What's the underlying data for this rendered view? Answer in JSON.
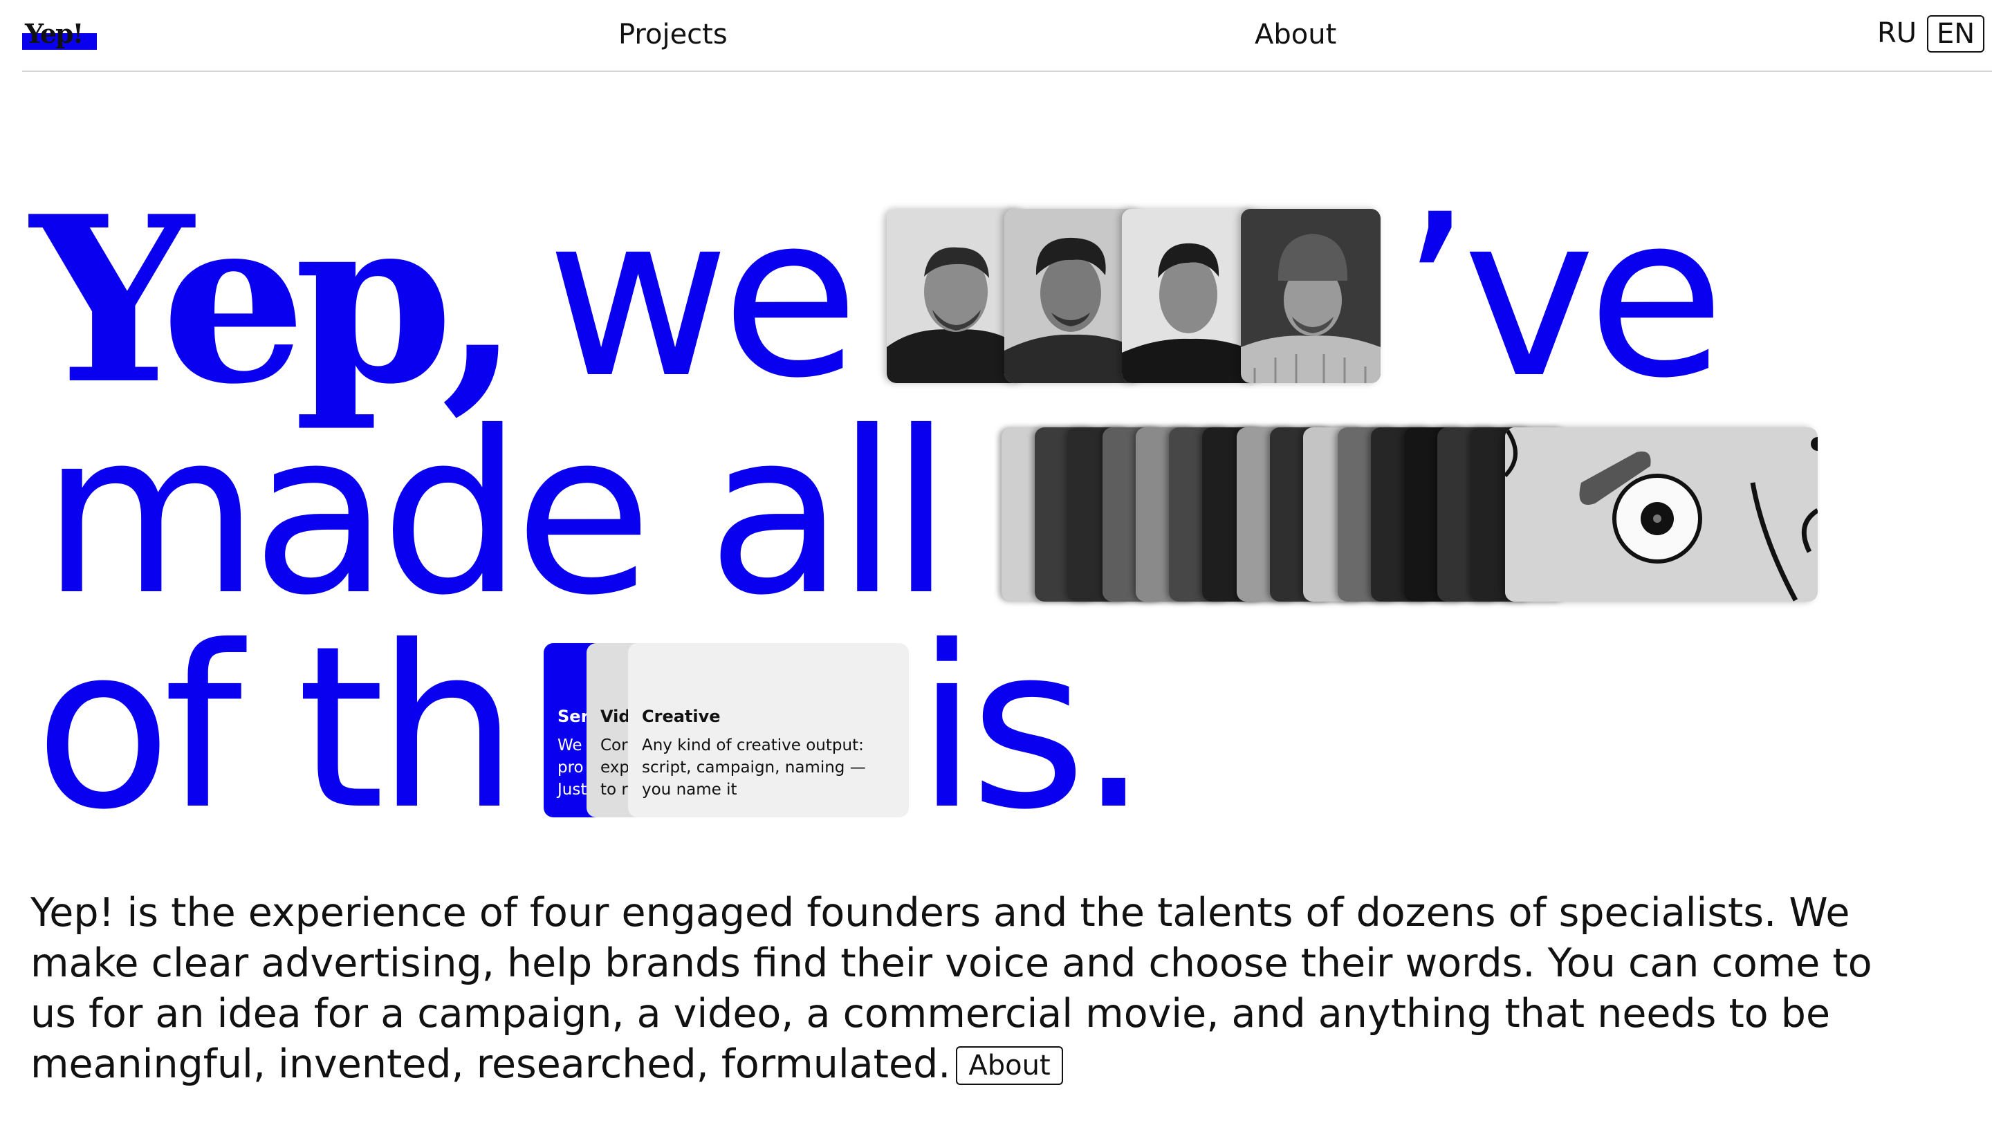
{
  "header": {
    "logo_text": "Yep!",
    "nav": {
      "projects": "Projects",
      "about": "About"
    },
    "languages": [
      "RU",
      "EN"
    ],
    "active_language": "EN"
  },
  "hero": {
    "line1_brand": "Yep,",
    "line1_word": "we",
    "line1_end": "’ve",
    "line2": "made all",
    "line3_start": "of th",
    "line3_end": "is."
  },
  "services": [
    {
      "title": "Ser",
      "desc": "We pro Just"
    },
    {
      "title": "Vid",
      "desc": "Cor exp to r"
    },
    {
      "title": "Creative",
      "desc": "Any kind of creative output: script, campaign, naming — you name it"
    }
  ],
  "intro": {
    "text": "Yep! is the experience of four engaged founders and the talents of dozens of specialists. We make clear advertising, help brands find their voice and choose their words. You can come to us for an idea for a campaign, a video, a commercial movie, and anything that needs to be meaningful, invented, researched, formulated.",
    "button_label": "About"
  },
  "colors": {
    "accent": "#0a00f0",
    "text": "#111111",
    "card_grey": "#f0f0f0",
    "divider": "#d6d6d6"
  }
}
